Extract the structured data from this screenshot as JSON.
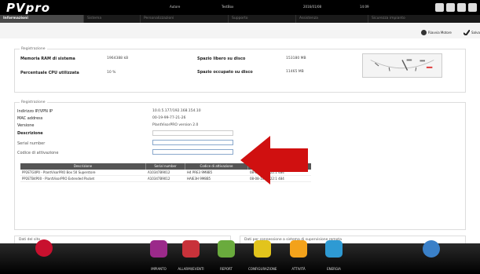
{
  "app": {
    "logo": "PVpro"
  },
  "topbar": {
    "user": "Autore",
    "place": "TestBox",
    "date": "2016/01/08",
    "time": "14:09"
  },
  "tabs": [
    {
      "label": "Informazioni",
      "active": true
    },
    {
      "label": "Sistema",
      "active": false
    },
    {
      "label": "Personalizzazioni",
      "active": false
    },
    {
      "label": "Supporto",
      "active": false
    },
    {
      "label": "Assistenza",
      "active": false
    },
    {
      "label": "Sicurezza impianto",
      "active": false
    }
  ],
  "actions": {
    "restart": "Riavvia Motore",
    "save": "Salva"
  },
  "sysinfo": {
    "legend": "Registrazione",
    "ram_label": "Memoria RAM di sistema",
    "ram_value": "1964388 kB",
    "cpu_label": "Percentuale CPU utilizzata",
    "cpu_value": "10 %",
    "free_label": "Spazio libero su disco",
    "free_value": "153180 MB",
    "used_label": "Spazio occupato su disco",
    "used_value": "11465 MB"
  },
  "registration": {
    "legend": "Registrazione",
    "ip_label": "Indirizzo IP/VPN IP",
    "ip_value": "10.0.5.177/192.168.154.10",
    "mac_label": "MAC address",
    "mac_value": "00-19-99-77-21-26",
    "version_label": "Versione",
    "version_value": "PlantVisorPRO version 2.0",
    "desc_label": "Descrizione",
    "serial_label": "Serial number",
    "activation_label": "Codice di attivazione"
  },
  "table": {
    "headers": [
      "Descrizione",
      "Serial number",
      "Codice di attivazione",
      "Data"
    ],
    "rows": [
      [
        "PP2ETG0P0 - PlantVisorPRO Box 50 Superstore",
        "A10347B9012",
        "H4 PRE3 9M8B5",
        "08-08-16 09:22:1 484"
      ],
      [
        "PP2ETB4P00 - PlantVisorPRO Extended Packet",
        "A10347B9012",
        "HAIE3H 9M8B5",
        "08-08-16 09:22:1 484"
      ]
    ]
  },
  "footer": {
    "site_label": "Dati del sito",
    "remote_label": "Dati per connessione a sistema di supervisione remota"
  },
  "bottomnav": [
    {
      "label": "IMPIANTO",
      "color": "#9b2a8a"
    },
    {
      "label": "ALLARMI/EVENTI",
      "color": "#c8323a"
    },
    {
      "label": "REPORT",
      "color": "#6aab3d"
    },
    {
      "label": "CONFIGURAZIONE",
      "color": "#e2c41c"
    },
    {
      "label": "ATTIVITÀ",
      "color": "#f3a21b"
    },
    {
      "label": "ENERGIA",
      "color": "#2e9ad3"
    }
  ]
}
